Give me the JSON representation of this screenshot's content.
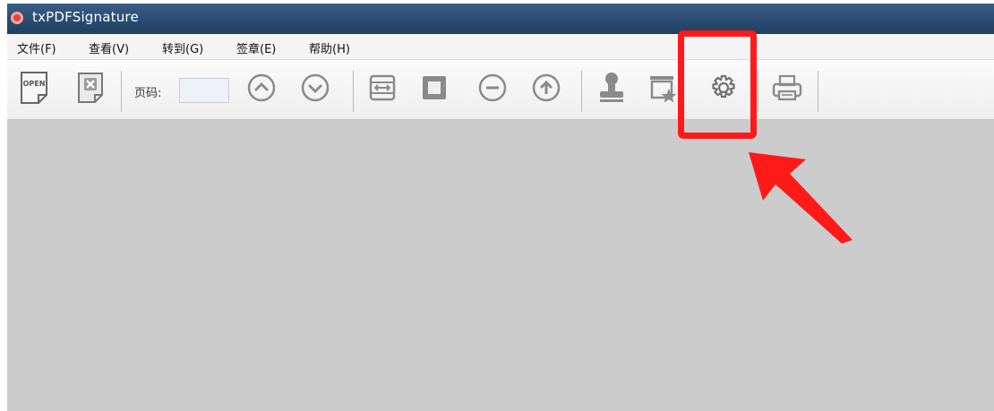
{
  "window": {
    "title": "txPDFSignature",
    "app_icon": "app-logo-icon"
  },
  "menu": {
    "items": [
      {
        "label": "文件(F)"
      },
      {
        "label": "查看(V)"
      },
      {
        "label": "转到(G)"
      },
      {
        "label": "签章(E)"
      },
      {
        "label": "帮助(H)"
      }
    ]
  },
  "toolbar": {
    "open_label": "OPEN",
    "page_label": "页码:",
    "page_value": "",
    "buttons": [
      "open-file-icon",
      "close-file-icon",
      "previous-page-icon",
      "next-page-icon",
      "fit-width-icon",
      "fit-page-icon",
      "zoom-out-icon",
      "zoom-in-icon",
      "stamp-icon",
      "signature-field-icon",
      "settings-gear-icon",
      "print-icon"
    ]
  },
  "annotation": {
    "highlight_color": "#ff1a1a",
    "target": "settings-gear-icon"
  },
  "colors": {
    "workspace_bg": "#cccccc",
    "title_bar": "#2f5279",
    "highlight": "#ff1a1a"
  }
}
